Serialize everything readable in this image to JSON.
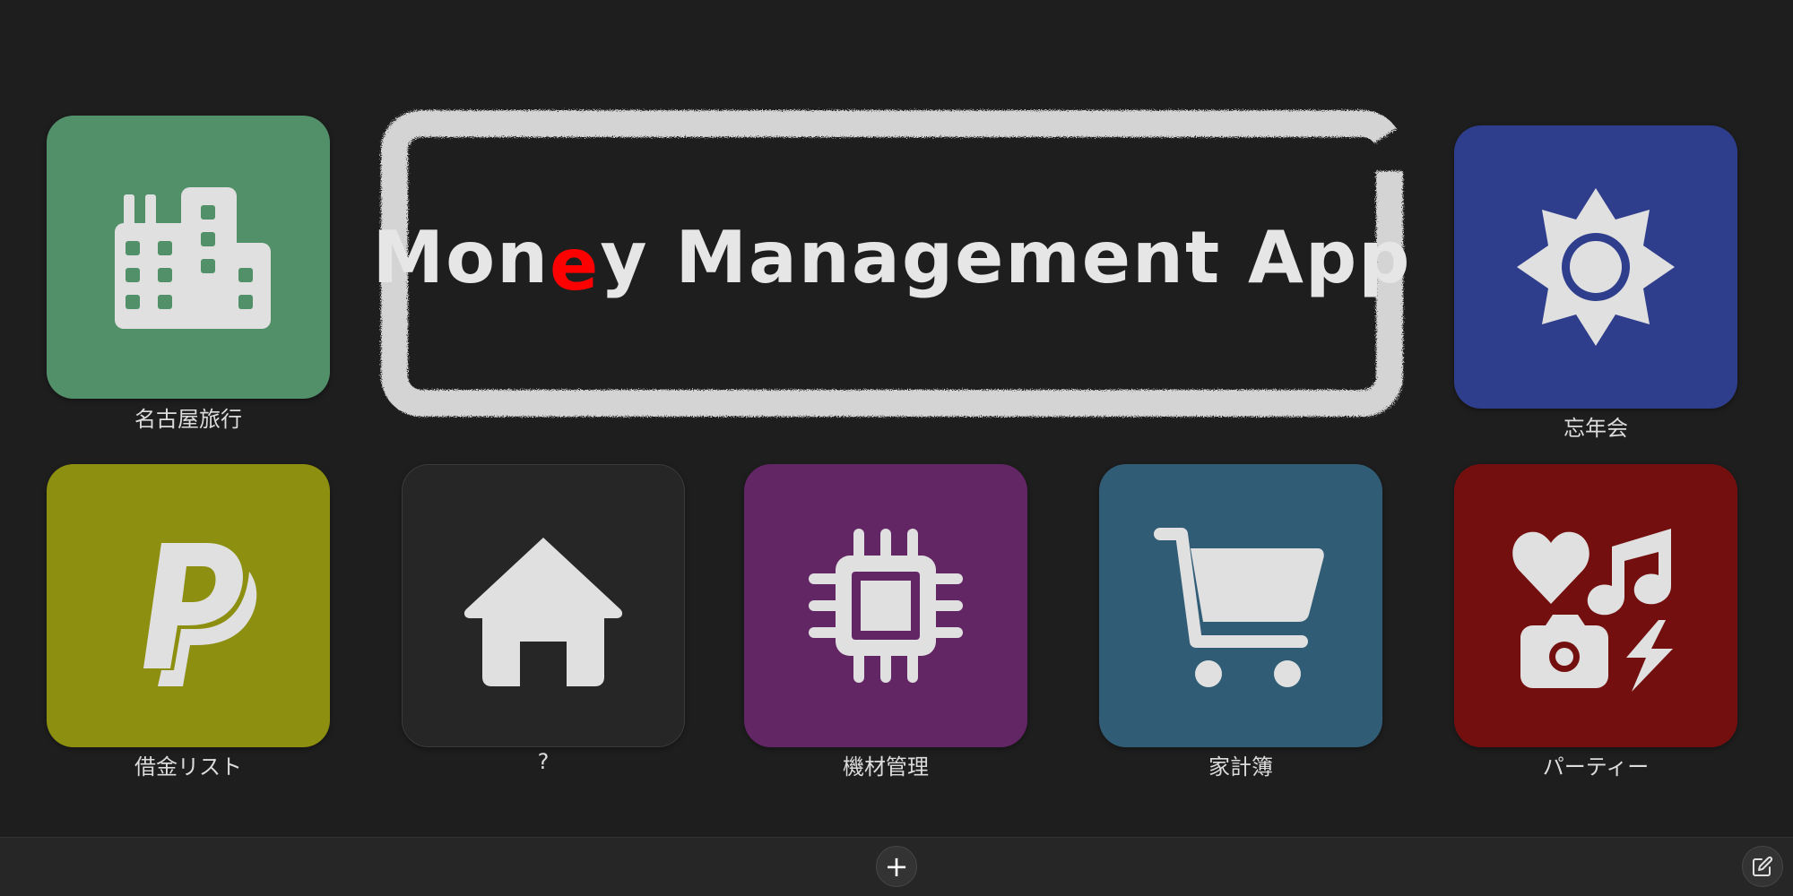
{
  "title": {
    "text": "Money Management App",
    "highlight_char": "e",
    "highlight_color": "#ff0000"
  },
  "tiles": [
    {
      "label": "名古屋旅行",
      "icon": "building-icon",
      "color": "#52906a"
    },
    {
      "label": "忘年会",
      "icon": "sun-icon",
      "color": "#2f3d8d"
    },
    {
      "label": "借金リスト",
      "icon": "paypal-icon",
      "color": "#8d8f10"
    },
    {
      "label": "?",
      "icon": "house-icon",
      "color": "#262626"
    },
    {
      "label": "機材管理",
      "icon": "microchip-icon",
      "color": "#622664"
    },
    {
      "label": "家計簿",
      "icon": "cart-icon",
      "color": "#315c76"
    },
    {
      "label": "パーティー",
      "icon": "icons-icon",
      "color": "#740f0f"
    }
  ],
  "bottom_bar": {
    "add_label": "+",
    "add_icon": "plus-icon",
    "edit_icon": "edit-icon"
  }
}
